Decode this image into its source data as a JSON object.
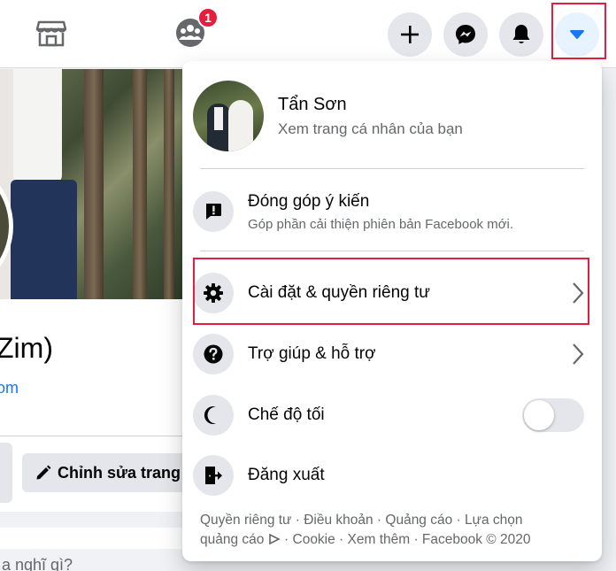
{
  "topbar": {
    "icons": {
      "marketplace": "marketplace-icon",
      "groups": "groups-icon",
      "create": "plus-icon",
      "messenger": "messenger-icon",
      "notifications": "bell-icon",
      "account": "caret-down-icon"
    },
    "groups_badge": "1",
    "badge_color": "#e41e3f",
    "accent_color": "#1877f2"
  },
  "background": {
    "profile_name_fragment": "Zim)",
    "profile_link_fragment": "om",
    "edit_button_label": "Chỉnh sửa trang",
    "post_prompt_fragment": "a nghĩ gì?"
  },
  "menu": {
    "profile": {
      "name": "Tẩn Sơn",
      "subtitle": "Xem trang cá nhân của bạn"
    },
    "feedback": {
      "title": "Đóng góp ý kiến",
      "subtitle": "Góp phần cải thiện phiên bản Facebook mới."
    },
    "items": [
      {
        "label": "Cài đặt & quyền riêng tư",
        "icon": "gear-icon",
        "has_chevron": true,
        "highlighted": true
      },
      {
        "label": "Trợ giúp & hỗ trợ",
        "icon": "question-icon",
        "has_chevron": true
      },
      {
        "label": "Chế độ tối",
        "icon": "moon-icon",
        "toggle": false
      },
      {
        "label": "Đăng xuất",
        "icon": "logout-icon"
      }
    ],
    "footer": {
      "line1": "Quyền riêng tư · Điều khoản · Quảng cáo · Lựa chọn",
      "line2_a": "quảng cáo",
      "line2_b": "· Cookie · Xem thêm · Facebook © 2020"
    }
  }
}
